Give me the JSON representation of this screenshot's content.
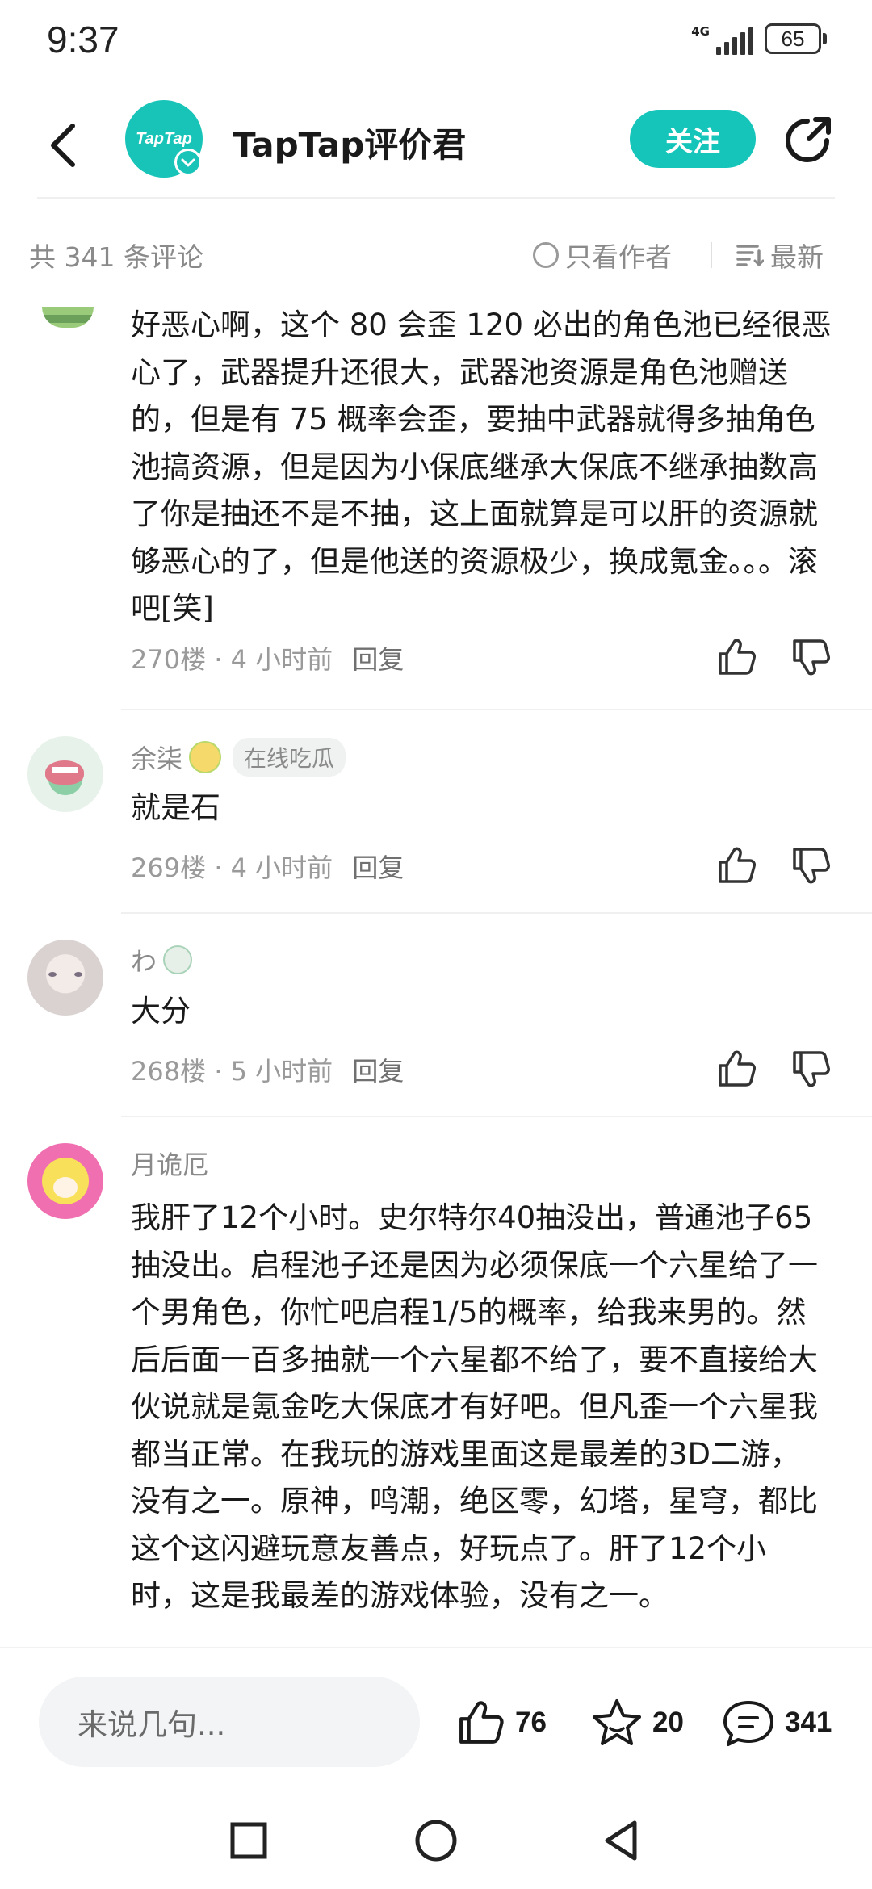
{
  "status_bar": {
    "time": "9:37",
    "network": "4G",
    "battery": "65"
  },
  "header": {
    "avatar_text": "TapTap",
    "title": "TapTap评价君",
    "follow_label": "关注"
  },
  "filter_bar": {
    "count_text": "共 341 条评论",
    "author_only_label": "只看作者",
    "sort_label": "最新"
  },
  "comments": [
    {
      "user": "",
      "badge": "",
      "body": "好恶心啊，这个 80 会歪 120 必出的角色池已经很恶心了，武器提升还很大，武器池资源是角色池赠送的，但是有 75 概率会歪，要抽中武器就得多抽角色池搞资源，但是因为小保底继承大保底不继承抽数高了你是抽还不是不抽，这上面就算是可以肝的资源就够恶心的了，但是他送的资源极少，换成氪金。。。滚吧[笑]",
      "floor": "270楼",
      "time": "4 小时前",
      "reply": "回复"
    },
    {
      "user": "余柒",
      "badge": "在线吃瓜",
      "body": "就是石",
      "floor": "269楼",
      "time": "4 小时前",
      "reply": "回复"
    },
    {
      "user": "わ",
      "badge": "",
      "body": "大分",
      "floor": "268楼",
      "time": "5 小时前",
      "reply": "回复"
    },
    {
      "user": "月诡厄",
      "badge": "",
      "body": "我肝了12个小时。史尔特尔40抽没出，普通池子65抽没出。启程池子还是因为必须保底一个六星给了一个男角色，你忙吧启程1/5的概率，给我来男的。然后后面一百多抽就一个六星都不给了，要不直接给大伙说就是氪金吃大保底才有好吧。但凡歪一个六星我都当正常。在我玩的游戏里面这是最差的3D二游，没有之一。原神，鸣潮，绝区零，幻塔，星穹，都比这个这闪避玩意友善点，好玩点了。肝了12个小时，这是我最差的游戏体验，没有之一。"
    }
  ],
  "bottom_bar": {
    "input_placeholder": "来说几句...",
    "likes": "76",
    "favorites": "20",
    "comments": "341"
  }
}
